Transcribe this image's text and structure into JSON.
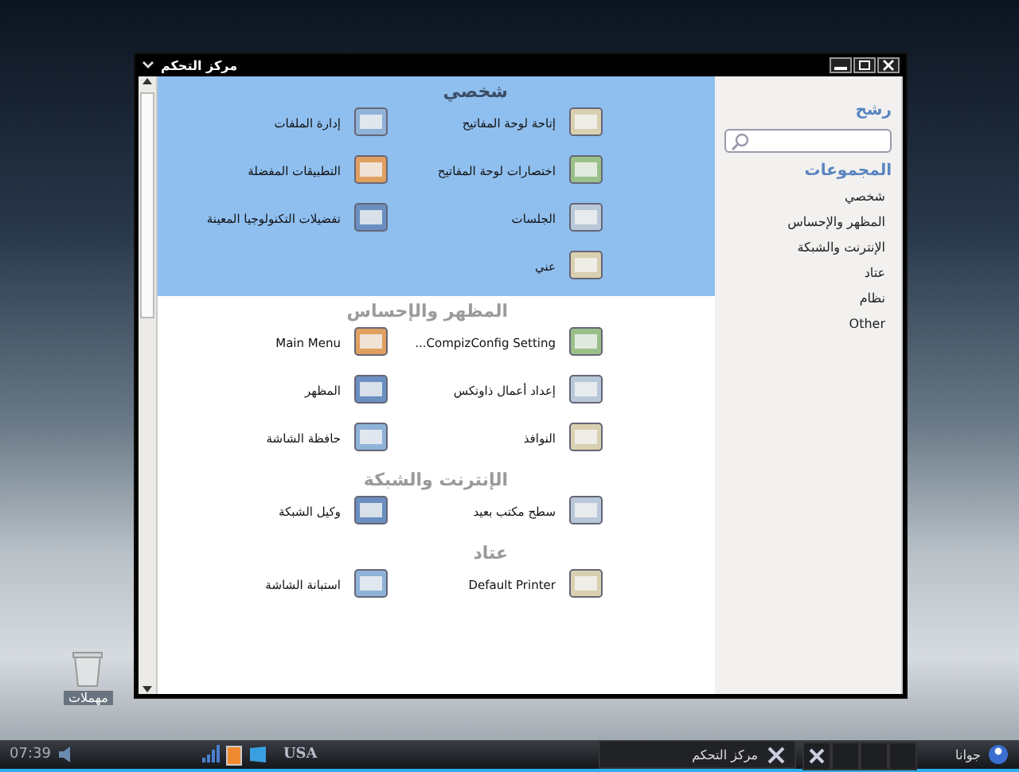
{
  "window": {
    "title": "مركز التحكم"
  },
  "sections": [
    {
      "title": "شخصي",
      "selected": true,
      "items": [
        "إتاحة لوحة المفاتيح",
        "إدارة الملفات",
        "اختصارات لوحة المفاتيح",
        "التطبيقات المفضلة",
        "الجلسات",
        "تفضيلات التكنولوجيا المعينة",
        "عني"
      ]
    },
    {
      "title": "المظهر والإحساس",
      "selected": false,
      "items": [
        "CompizConfig Setting...",
        "Main Menu",
        "إعداد أعمال ذاوتكس",
        "المظهر",
        "النوافذ",
        "حافظة الشاشة"
      ]
    },
    {
      "title": "الإنترنت والشبكة",
      "selected": false,
      "items": [
        "سطح مكتب بعيد",
        "وكيل الشبكة"
      ]
    },
    {
      "title": "عتاد",
      "selected": false,
      "items": [
        "Default Printer",
        "استبانة الشاشة"
      ]
    }
  ],
  "sidebar": {
    "filter_label": "رشح",
    "groups_label": "المجموعات",
    "groups": [
      "شخصي",
      "المظهر والإحساس",
      "الإنترنت والشبكة",
      "عتاد",
      "نظام",
      "Other"
    ]
  },
  "desktop": {
    "icons": [
      "مهملات"
    ]
  },
  "taskbar": {
    "clock": "07:39",
    "keyboard": "USA",
    "tasks": [
      "مركز التحكم"
    ],
    "user": "جوانا"
  }
}
